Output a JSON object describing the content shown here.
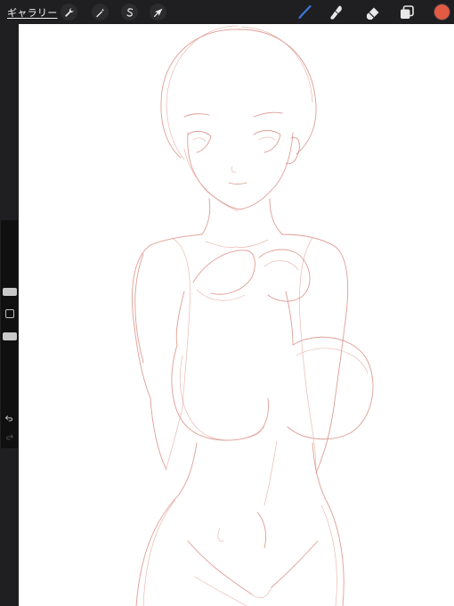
{
  "topbar": {
    "gallery_label": "ギャラリー",
    "left_tools": [
      {
        "name": "wrench-icon",
        "meaning": "actions"
      },
      {
        "name": "magic-wand-icon",
        "meaning": "adjustments"
      },
      {
        "name": "selection-s-icon",
        "meaning": "selection"
      },
      {
        "name": "arrow-cursor-icon",
        "meaning": "transform"
      }
    ],
    "right_tools": [
      {
        "name": "brush-icon",
        "meaning": "paint",
        "active": true
      },
      {
        "name": "smudge-icon",
        "meaning": "smudge"
      },
      {
        "name": "eraser-icon",
        "meaning": "erase"
      },
      {
        "name": "layers-icon",
        "meaning": "layers"
      }
    ],
    "current_color": "#e05a44"
  },
  "sidebar": {
    "icons": [
      "brush-size-slider",
      "modify-button-icon",
      "opacity-slider",
      "undo-icon",
      "redo-icon"
    ]
  },
  "canvas": {
    "background": "#ffffff",
    "sketch_color": "#d98d82",
    "content": "figure-sketch"
  },
  "colors": {
    "ui_dark": "#1f1f21",
    "accent_blue": "#3a7bdc"
  }
}
